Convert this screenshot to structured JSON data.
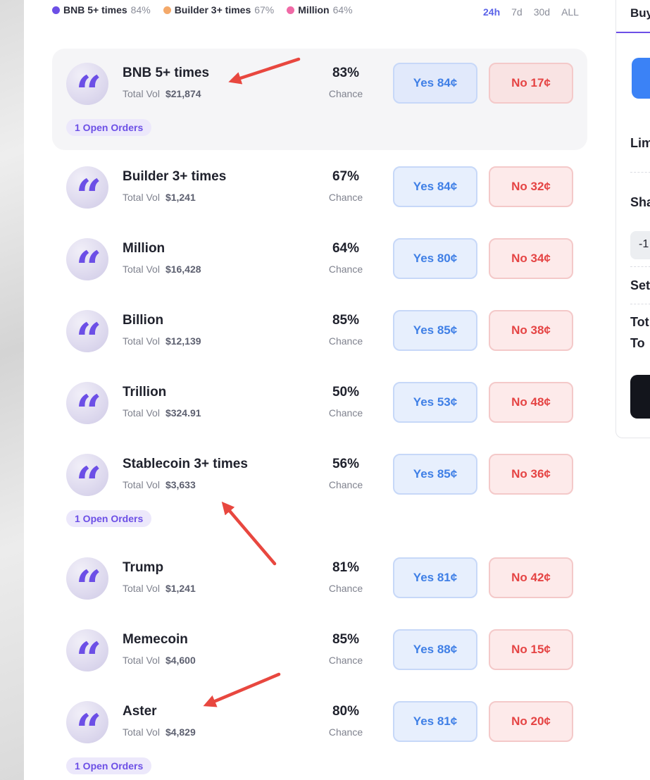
{
  "legend": [
    {
      "name": "BNB 5+ times",
      "pct": "84%",
      "color": "#6c4fe6"
    },
    {
      "name": "Builder 3+ times",
      "pct": "67%",
      "color": "#f4a96a"
    },
    {
      "name": "Million",
      "pct": "64%",
      "color": "#f06aa6"
    }
  ],
  "time_filters": [
    {
      "label": "24h",
      "active": true
    },
    {
      "label": "7d",
      "active": false
    },
    {
      "label": "30d",
      "active": false
    },
    {
      "label": "ALL",
      "active": false
    }
  ],
  "vol_label": "Total Vol",
  "chance_label": "Chance",
  "markets": [
    {
      "title": "BNB 5+ times",
      "vol": "$21,874",
      "pct": "83%",
      "yes": "Yes 84¢",
      "no": "No 17¢",
      "orders": "1 Open Orders"
    },
    {
      "title": "Builder 3+ times",
      "vol": "$1,241",
      "pct": "67%",
      "yes": "Yes 84¢",
      "no": "No 32¢"
    },
    {
      "title": "Million",
      "vol": "$16,428",
      "pct": "64%",
      "yes": "Yes 80¢",
      "no": "No 34¢"
    },
    {
      "title": "Billion",
      "vol": "$12,139",
      "pct": "85%",
      "yes": "Yes 85¢",
      "no": "No 38¢"
    },
    {
      "title": "Trillion",
      "vol": "$324.91",
      "pct": "50%",
      "yes": "Yes 53¢",
      "no": "No 48¢"
    },
    {
      "title": "Stablecoin 3+ times",
      "vol": "$3,633",
      "pct": "56%",
      "yes": "Yes 85¢",
      "no": "No 36¢",
      "orders": "1 Open Orders"
    },
    {
      "title": "Trump",
      "vol": "$1,241",
      "pct": "81%",
      "yes": "Yes 81¢",
      "no": "No 42¢"
    },
    {
      "title": "Memecoin",
      "vol": "$4,600",
      "pct": "85%",
      "yes": "Yes 88¢",
      "no": "No 15¢"
    },
    {
      "title": "Aster",
      "vol": "$4,829",
      "pct": "80%",
      "yes": "Yes 81¢",
      "no": "No 20¢",
      "orders": "1 Open Orders"
    }
  ],
  "right_panel": {
    "tab": "Buy",
    "limit_label": "Lim",
    "shares_label": "Sha",
    "shares_value": "-1",
    "set_label": "Set",
    "total_label": "Tot",
    "to_label": "To"
  },
  "avatar_glyph": "“",
  "colors": {
    "accent": "#6c4fe6",
    "yes": "#3f7fe6",
    "no": "#e54444",
    "annotation_arrow": "#e8473f"
  }
}
